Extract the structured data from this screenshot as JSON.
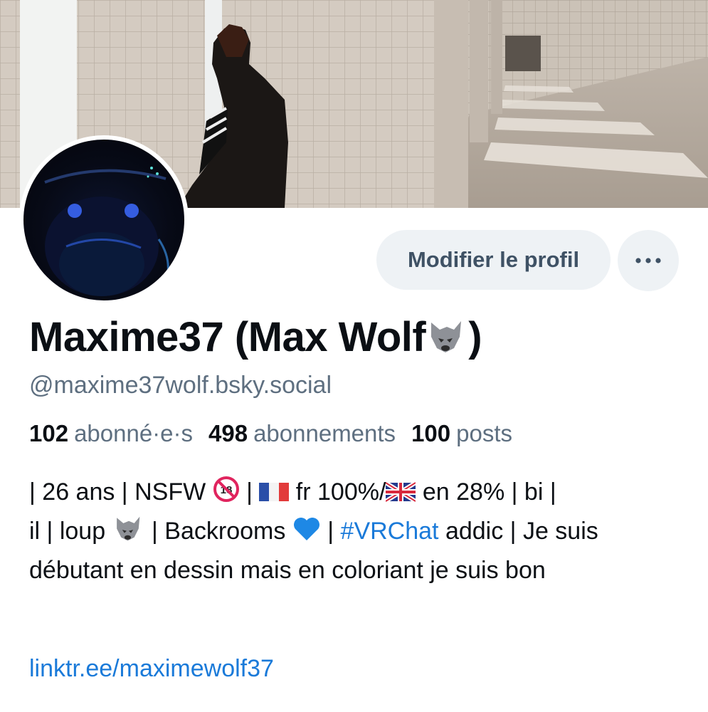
{
  "profile": {
    "display_name": "Maxime37 (Max Wolf",
    "display_name_end": ")",
    "handle": "@maxime37wolf.bsky.social",
    "edit_button_label": "Modifier le profil",
    "more_icon": "ellipsis-icon"
  },
  "stats": {
    "followers_count": "102",
    "followers_label": "abonné·e·s",
    "following_count": "498",
    "following_label": "abonnements",
    "posts_count": "100",
    "posts_label": "posts"
  },
  "bio": {
    "seg1": "| 26 ans | NSFW ",
    "seg2": " | ",
    "seg3": " fr 100%/",
    "seg4": " en 28% | bi |",
    "seg5": "il | loup ",
    "seg6": " | Backrooms ",
    "seg7": " | ",
    "hashtag": "#VRChat",
    "seg8": " addic | Je suis débutant en dessin mais en coloriant je suis bon"
  },
  "link": "linktr.ee/maximewolf37",
  "colors": {
    "accent": "#1a7ad9",
    "muted_text": "#5e6f80",
    "button_bg": "#eef2f5"
  }
}
